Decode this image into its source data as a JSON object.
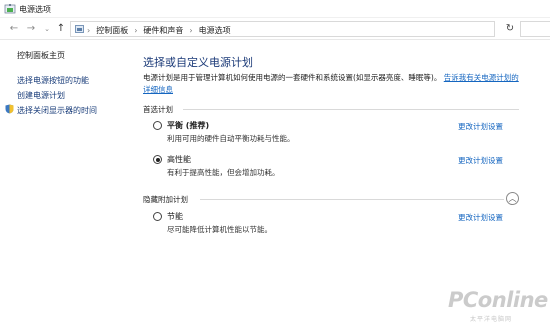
{
  "window": {
    "title": "电源选项"
  },
  "nav": {
    "back_icon": "arrow-left-icon",
    "forward_icon": "arrow-right-icon",
    "recent_icon": "chevron-down-icon",
    "up_icon": "arrow-up-icon",
    "refresh_icon": "refresh-icon"
  },
  "address": {
    "crumbs": [
      "控制面板",
      "硬件和声音",
      "电源选项"
    ],
    "separator": "›"
  },
  "sidebar": {
    "home": "控制面板主页",
    "links": [
      "选择电源按钮的功能",
      "创建电源计划",
      "选择关闭显示器的时间"
    ]
  },
  "main": {
    "title": "选择或自定义电源计划",
    "description": "电源计划是用于管理计算机如何使用电源的一套硬件和系统设置(如显示器亮度、睡眠等)。",
    "description_link": "告诉我有关电源计划的详细信息",
    "preferred_header": "首选计划",
    "hidden_header": "隐藏附加计划",
    "collapse_icon": "chevron-up-icon",
    "plans": [
      {
        "name": "平衡 (推荐)",
        "desc": "利用可用的硬件自动平衡功耗与性能。",
        "link": "更改计划设置",
        "selected": false,
        "bold": true
      },
      {
        "name": "高性能",
        "desc": "有利于提高性能，但会增加功耗。",
        "link": "更改计划设置",
        "selected": true,
        "bold": false
      }
    ],
    "hidden_plans": [
      {
        "name": "节能",
        "desc": "尽可能降低计算机性能以节能。",
        "link": "更改计划设置",
        "selected": false
      }
    ]
  },
  "watermark": {
    "brand": "PConline",
    "sub": "太平洋电脑网"
  },
  "colors": {
    "link": "#1566c0",
    "title": "#1b3a78",
    "app_icon_green": "#4caf50"
  }
}
